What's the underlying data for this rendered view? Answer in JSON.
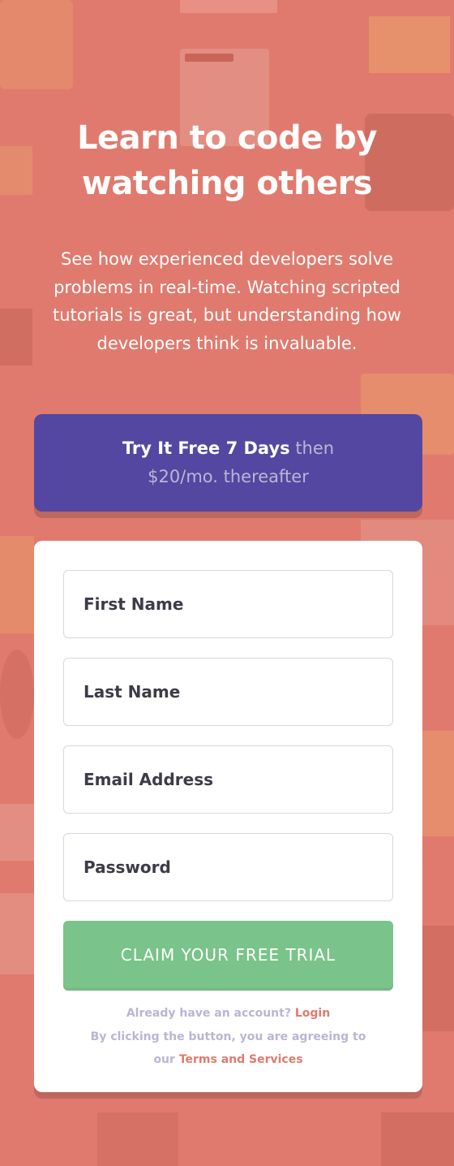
{
  "hero": {
    "title_line1": "Learn to code by",
    "title_line2": "watching others",
    "description": "See how experienced developers solve problems in real-time. Watching scripted tutorials is great, but understanding how developers think is invaluable."
  },
  "offer": {
    "highlight": "Try It Free 7 Days",
    "rest": "then $20/mo. thereafter"
  },
  "form": {
    "first_name_placeholder": "First Name",
    "last_name_placeholder": "Last Name",
    "email_placeholder": "Email Address",
    "password_placeholder": "Password",
    "submit_label": "CLAIM YOUR FREE TRIAL",
    "account_text": "Already have an account?",
    "login_link": "Login",
    "terms_text_1": "By clicking the button, you are agreeing to",
    "terms_text_2": "our",
    "terms_link": "Terms and Services"
  },
  "colors": {
    "background": "#e07a6e",
    "offer_bg": "#5347a1",
    "submit_bg": "#7ac38a",
    "link": "#e07a6e",
    "muted_text": "#b9b6d3"
  }
}
